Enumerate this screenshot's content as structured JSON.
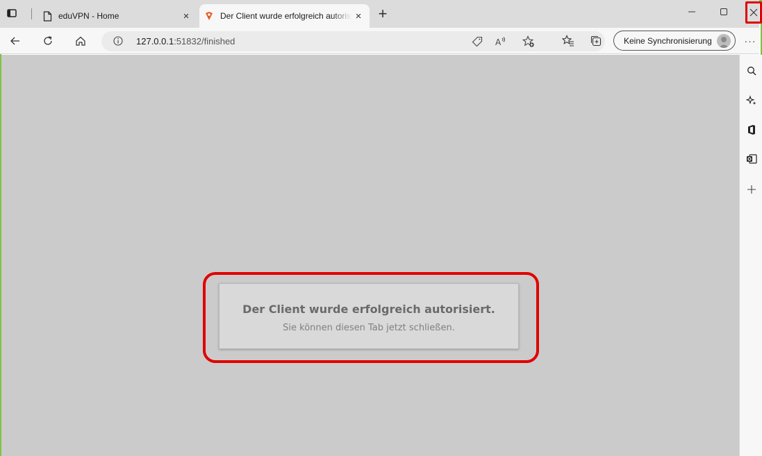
{
  "tabs": [
    {
      "title": "eduVPN - Home",
      "close": "×",
      "active": false
    },
    {
      "title": "Der Client wurde erfolgreich autorisiert",
      "close": "×",
      "active": true
    }
  ],
  "new_tab": "+",
  "address": {
    "host": "127.0.0.1",
    "path": ":51832/finished"
  },
  "sync": {
    "label": "Keine Synchronisierung"
  },
  "more": "···",
  "sidebar": [
    "search-icon",
    "copilot-icon",
    "office-icon",
    "outlook-icon",
    "add-icon"
  ],
  "card": {
    "heading": "Der Client wurde erfolgreich autorisiert.",
    "message": "Sie können diesen Tab jetzt schließen."
  },
  "colors": {
    "highlight": "#e00000",
    "content_bg": "#cbcbcb",
    "window_border": "#7dc242"
  }
}
